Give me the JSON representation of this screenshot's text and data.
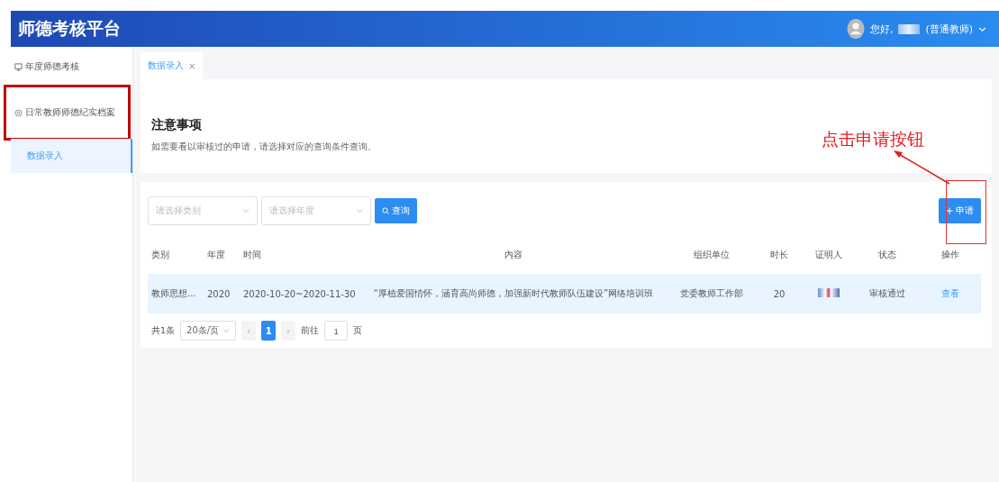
{
  "header": {
    "title": "师德考核平台",
    "greeting": "您好,",
    "role": "(普通教师)"
  },
  "sidebar": {
    "items": [
      {
        "label": "年度师德考核",
        "kind": "monitor",
        "highlighted": false
      },
      {
        "label": "日常教师师德纪实档案",
        "kind": "gear",
        "highlighted": true,
        "children": [
          {
            "label": "数据录入",
            "selected": true
          }
        ]
      }
    ]
  },
  "tabs": [
    {
      "label": "数据录入",
      "close": "×",
      "selected": true
    }
  ],
  "notice": {
    "title": "注意事项",
    "text": "如需要看以审核过的申请，请选择对应的查询条件查询。"
  },
  "filters": [
    {
      "placeholder": "请选择类别"
    },
    {
      "placeholder": "请选择年度"
    }
  ],
  "search_button": "查询",
  "apply_button": "申请",
  "annotation": "点击申请按钮",
  "table": {
    "columns": [
      "类别",
      "年度",
      "时间",
      "内容",
      "组织单位",
      "时长",
      "证明人",
      "状态",
      "操作"
    ],
    "rows": [
      {
        "cells": [
          "教师思想...",
          "2020",
          "2020-10-20~2020-11-30",
          "“厚植爱国情怀，涵育高尚师德，加强新时代教师队伍建设”网络培训班",
          "党委教师工作部",
          "20",
          "",
          "审核通过",
          "查看"
        ],
        "selected": true
      }
    ]
  },
  "pagination": {
    "total": "共1条",
    "page_size": "20条/页",
    "prev": "‹",
    "next": "›",
    "pages": [
      {
        "label": "1",
        "selected": true
      }
    ],
    "goto_label": "前往",
    "goto_value": "1",
    "goto_suffix": "页"
  }
}
